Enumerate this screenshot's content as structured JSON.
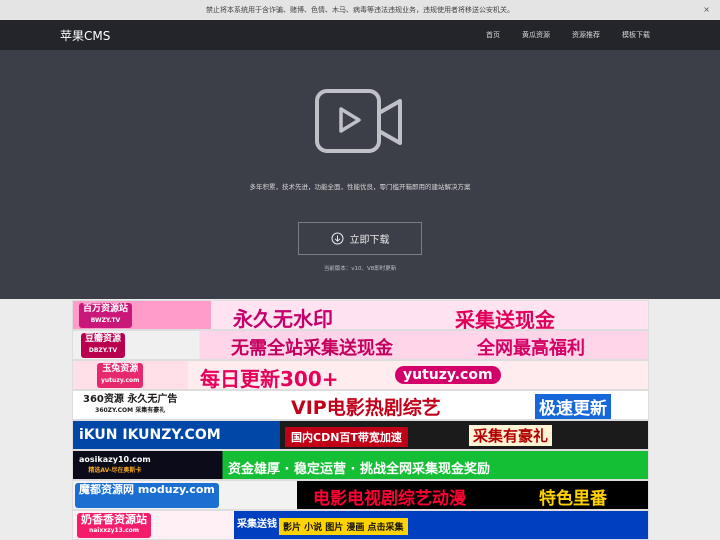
{
  "notice": {
    "text": "禁止将本系统用于含诈骗、赌博、色情、木马、病毒等违法违规业务，违规使用者将移送公安机关。",
    "close": "×"
  },
  "nav": {
    "brand": "苹果CMS",
    "items": [
      "首页",
      "黄瓜资源",
      "资源推荐",
      "模板下载"
    ]
  },
  "hero": {
    "tagline": "多年积累，技术先进，功能全面，性能优良，零门槛开箱即用的建站解决方案",
    "download_label": "立即下载",
    "version": "当前版本：v10、V8即时更新"
  },
  "banners": [
    {
      "logo": "百万资源站",
      "logo_sub": "BWZY.TV",
      "headline": "永久无水印",
      "extra": "采集送现金"
    },
    {
      "logo": "豆瓣资源",
      "logo_sub": "DBZY.TV",
      "headline": "无需全站采集送现金",
      "extra": "全网最高福利"
    },
    {
      "logo": "玉兔资源",
      "logo_sub": "yutuzy.com",
      "headline": "每日更新300+",
      "extra": "yutuzy.com"
    },
    {
      "logo": "360资源 永久无广告",
      "logo_sub": "360ZY.COM  采集有豪礼",
      "headline": "VIP电影热剧综艺",
      "extra": "极速更新"
    },
    {
      "logo": "iKUN",
      "logo_sub": "IKUNZY.COM",
      "headline": "国内CDN百T带宽加速",
      "extra": "采集有豪礼"
    },
    {
      "logo": "aosikazy10.com",
      "logo_sub": "精选AV-尽在奥斯卡",
      "headline": "资金雄厚 · 稳定运营 · 挑战全网采集现金奖励",
      "extra": ""
    },
    {
      "logo": "魔都资源网",
      "logo_sub": "moduzy.com",
      "headline": "电影电视剧综艺动漫",
      "extra": "特色里番"
    },
    {
      "logo": "奶香香资源站",
      "logo_sub": "naixxzy13.com",
      "headline": "采集送钱",
      "extra": "影片 小说 图片 漫画  点击采集"
    }
  ]
}
